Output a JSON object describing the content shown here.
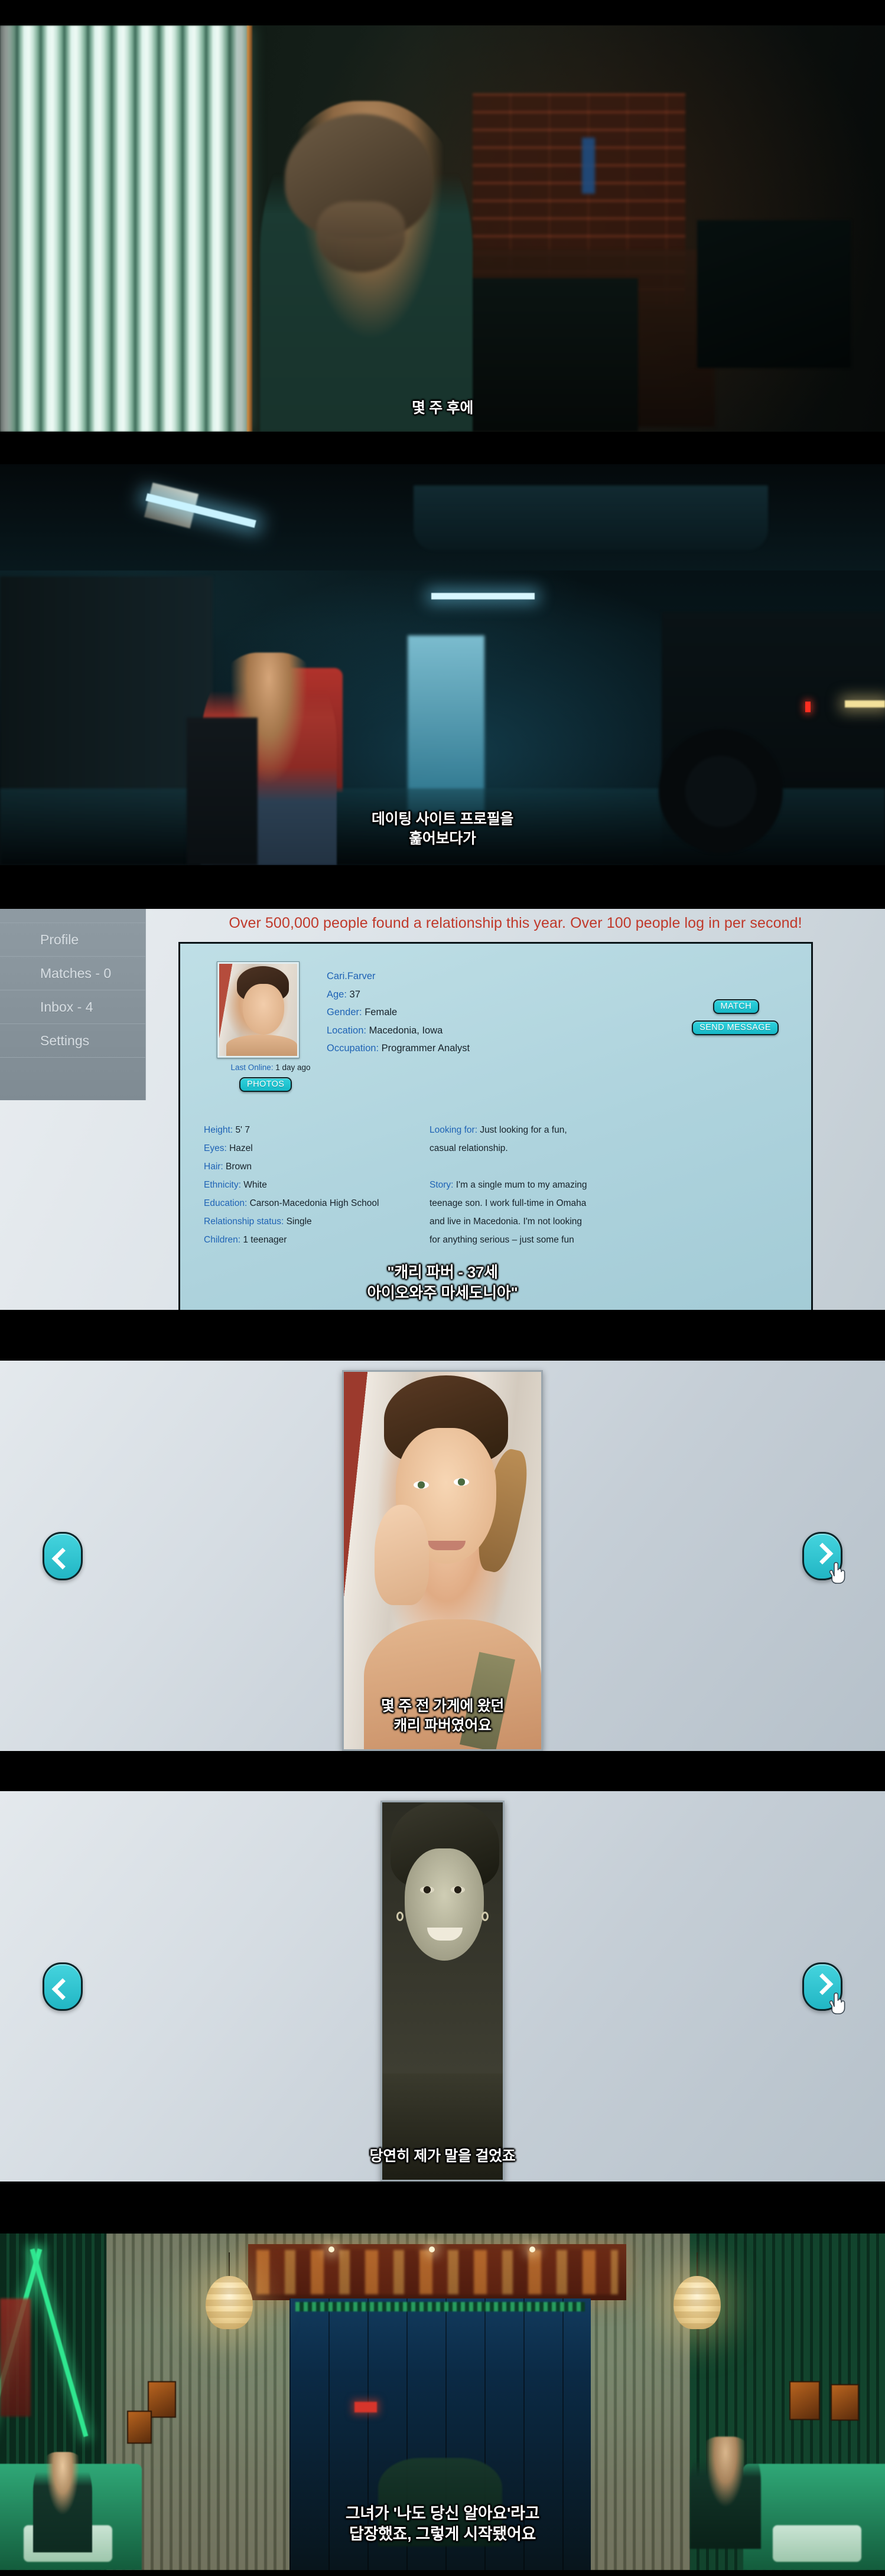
{
  "panels": {
    "p1": {
      "subtitle": "몇 주 후에"
    },
    "p2": {
      "subtitle_line1": "데이팅 사이트 프로필을",
      "subtitle_line2": "훑어보다가"
    },
    "p3": {
      "banner": "Over 500,000 people found a relationship this year. Over 100 people log in per second!",
      "sidebar": [
        {
          "label": "Profile"
        },
        {
          "label": "Matches - 0"
        },
        {
          "label": "Inbox - 4"
        },
        {
          "label": "Settings"
        }
      ],
      "profile": {
        "username": "Cari.Farver",
        "fields_head": [
          {
            "label": "Age:",
            "value": "37"
          },
          {
            "label": "Gender:",
            "value": "Female"
          },
          {
            "label": "Location:",
            "value": "Macedonia, Iowa"
          },
          {
            "label": "Occupation:",
            "value": "Programmer Analyst"
          }
        ],
        "last_online_label": "Last Online:",
        "last_online_value": "1 day ago",
        "buttons": {
          "match": "MATCH",
          "send_message": "SEND MESSAGE",
          "photos": "PHOTOS"
        },
        "left_column": [
          {
            "label": "Height:",
            "value": "5' 7"
          },
          {
            "label": "Eyes:",
            "value": "Hazel"
          },
          {
            "label": "Hair:",
            "value": "Brown"
          },
          {
            "label": "Ethnicity:",
            "value": "White"
          },
          {
            "label": "Education:",
            "value": "Carson-Macedonia High School"
          },
          {
            "label": "Relationship status:",
            "value": "Single"
          },
          {
            "label": "Children:",
            "value": "1 teenager"
          }
        ],
        "right_column": [
          {
            "label": "Looking for:",
            "value": "Just looking for a fun,"
          },
          {
            "label": "",
            "value": "casual relationship."
          },
          {
            "label": "Story:",
            "value": "I'm a single mum to my amazing"
          },
          {
            "label": "",
            "value": "teenage son. I work full-time in Omaha"
          },
          {
            "label": "",
            "value": "and live in Macedonia. I'm not looking"
          },
          {
            "label": "",
            "value": "for anything serious – just some fun"
          }
        ]
      },
      "subtitle_line1": "\"캐리 파버 - 37세",
      "subtitle_line2": "아이오와주 마세도니아\""
    },
    "p4": {
      "prev_label": "‹",
      "next_label": "›",
      "subtitle_line1": "몇 주 전 가게에 왔던",
      "subtitle_line2": "캐리 파버였어요"
    },
    "p5": {
      "prev_label": "‹",
      "next_label": "›",
      "subtitle": "당연히 제가 말을 걸었죠"
    },
    "p6": {
      "subtitle_line1": "그녀가 '나도 당신 알아요'라고",
      "subtitle_line2": "답장했죠, 그렇게 시작됐어요"
    }
  },
  "colors": {
    "banner_red": "#c0392b",
    "label_blue": "#1f63b5",
    "button_cyan": "#2fd2dd",
    "card_bg": "#b4d6de",
    "sidebar_gray": "#8f9ba3"
  }
}
